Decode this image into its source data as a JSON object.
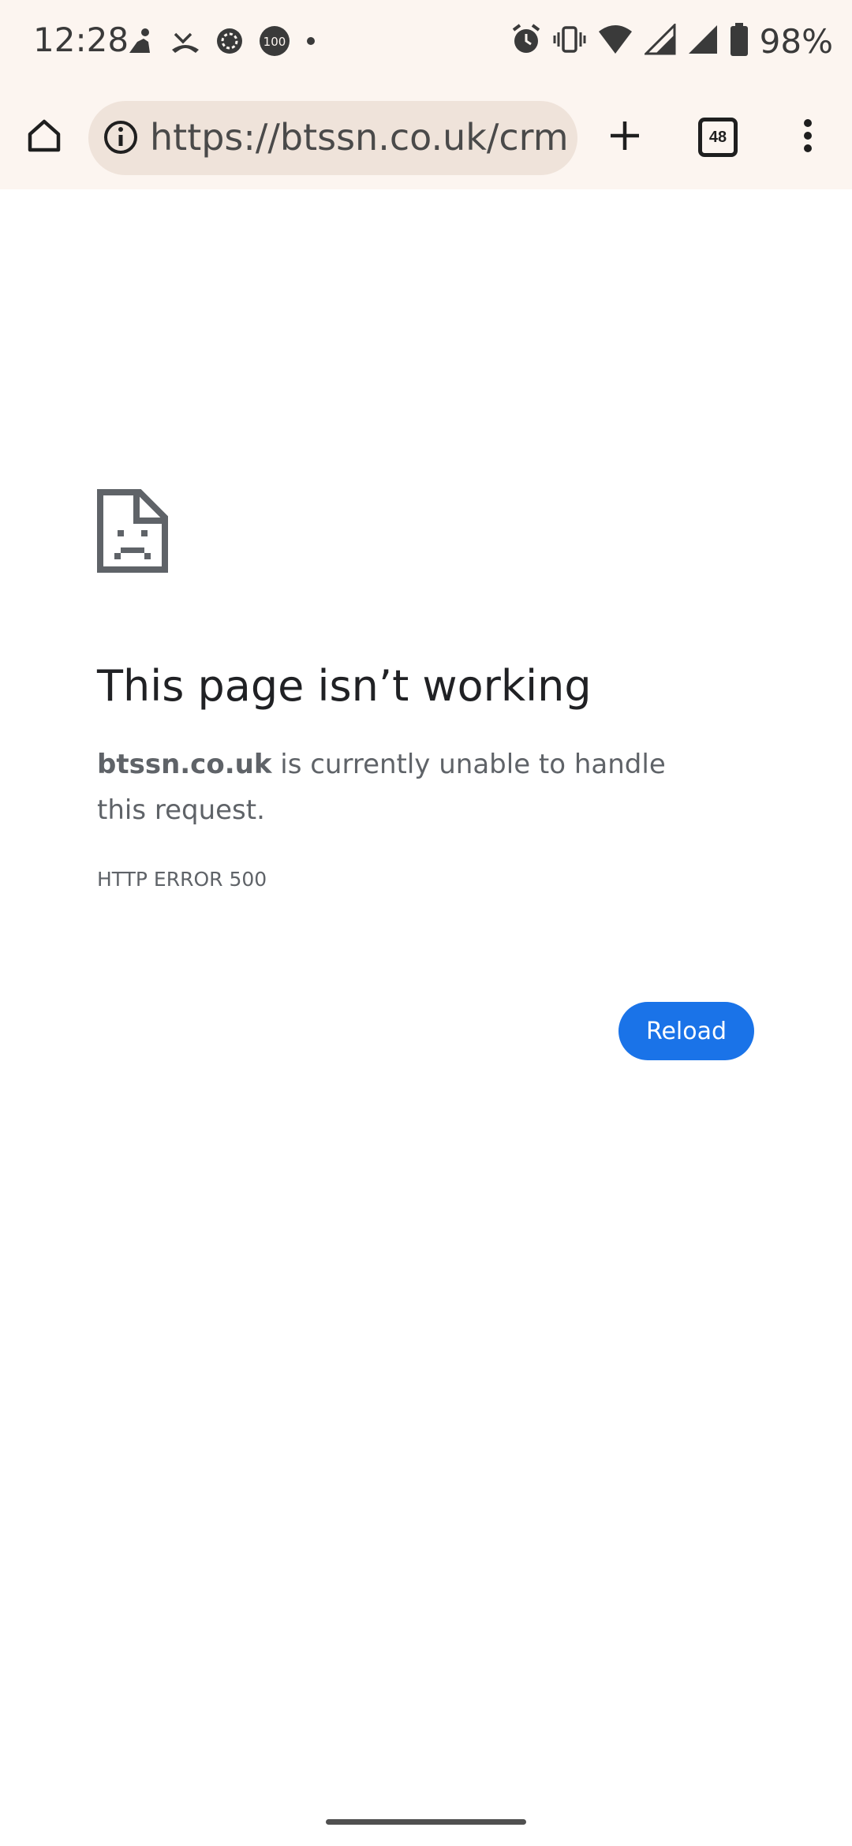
{
  "status_bar": {
    "time": "12:28",
    "battery_percent": "98%",
    "notification_badge": "100",
    "icons_left": [
      "person-app-icon",
      "missed-call-icon",
      "gear-badge-icon",
      "count-badge-icon",
      "dot-icon"
    ],
    "icons_right": [
      "alarm-icon",
      "vibrate-icon",
      "wifi-icon",
      "signal-icon",
      "signal-icon",
      "battery-icon"
    ]
  },
  "toolbar": {
    "url": "https://btssn.co.uk/crm/h",
    "tab_count": "48"
  },
  "error_page": {
    "title": "This page isn’t working",
    "domain": "btssn.co.uk",
    "message": " is currently unable to handle this request.",
    "error_code": "HTTP ERROR 500",
    "reload_label": "Reload"
  },
  "colors": {
    "top_background": "#fcf5f0",
    "url_pill_background": "#efe3da",
    "reload_button": "#1a73e8",
    "title_text": "#202124",
    "body_text": "#5f6368"
  }
}
